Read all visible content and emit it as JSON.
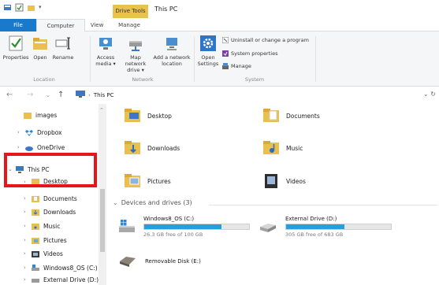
{
  "titlebar": {
    "context_tab": "Drive Tools",
    "title": "This PC"
  },
  "ribbon_tabs": [
    "File",
    "Computer",
    "View",
    "Manage"
  ],
  "ribbon": {
    "location": {
      "label": "Location",
      "buttons": [
        "Properties",
        "Open",
        "Rename"
      ]
    },
    "network": {
      "label": "Network",
      "buttons": [
        {
          "line1": "Access",
          "line2": "media ▾"
        },
        {
          "line1": "Map network",
          "line2": "drive ▾"
        },
        {
          "line1": "Add a network",
          "line2": "location"
        }
      ]
    },
    "system": {
      "label": "System",
      "open_settings": {
        "line1": "Open",
        "line2": "Settings"
      },
      "commands": [
        "Uninstall or change a program",
        "System properties",
        "Manage"
      ]
    }
  },
  "address": {
    "crumb": "This PC"
  },
  "nav": {
    "items": [
      {
        "label": "images",
        "indent": 1
      },
      {
        "label": "Dropbox",
        "indent": 0
      },
      {
        "label": "OneDrive",
        "indent": 0
      },
      {
        "label": "This PC",
        "indent": 0
      },
      {
        "label": "Desktop",
        "indent": 1
      },
      {
        "label": "Documents",
        "indent": 1
      },
      {
        "label": "Downloads",
        "indent": 1
      },
      {
        "label": "Music",
        "indent": 1
      },
      {
        "label": "Pictures",
        "indent": 1
      },
      {
        "label": "Videos",
        "indent": 1
      },
      {
        "label": "Windows8_OS (C:)",
        "indent": 1
      },
      {
        "label": "External Drive (D:)",
        "indent": 1
      }
    ]
  },
  "folders": [
    "Desktop",
    "Documents",
    "Downloads",
    "Music",
    "Pictures",
    "Videos"
  ],
  "devices": {
    "heading": "Devices and drives (3)",
    "drives": [
      {
        "name": "Windows8_OS (C:)",
        "free": "26.3 GB free of 100 GB",
        "used_fraction": 0.737
      },
      {
        "name": "External Drive (D:)",
        "free": "305 GB free of 683 GB",
        "used_fraction": 0.553
      },
      {
        "name": "Removable Disk (E:)"
      }
    ]
  },
  "colors": {
    "file_tab": "#1979ca",
    "context_tab": "#e9c24c",
    "drive_fill": "#26a0da",
    "highlight_box": "#e8141c"
  }
}
